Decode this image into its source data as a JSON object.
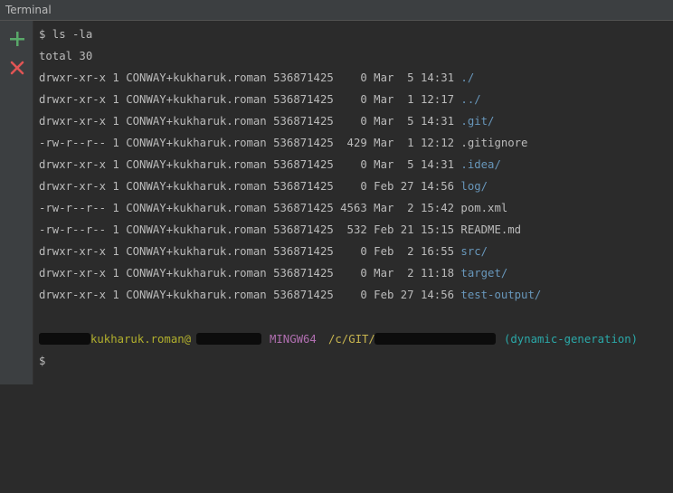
{
  "window": {
    "title": "Terminal"
  },
  "sidebar": {
    "icons": [
      {
        "name": "plus-icon",
        "color": "#59a869"
      },
      {
        "name": "close-icon",
        "color": "#e05555"
      }
    ]
  },
  "terminal": {
    "command": "$ ls -la",
    "total": "total 30",
    "entries": [
      {
        "meta": "drwxr-xr-x 1 CONWAY+kukharuk.roman 536871425    0 Mar  5 14:31 ",
        "name": "./",
        "is_dir": true
      },
      {
        "meta": "drwxr-xr-x 1 CONWAY+kukharuk.roman 536871425    0 Mar  1 12:17 ",
        "name": "../",
        "is_dir": true
      },
      {
        "meta": "drwxr-xr-x 1 CONWAY+kukharuk.roman 536871425    0 Mar  5 14:31 ",
        "name": ".git/",
        "is_dir": true
      },
      {
        "meta": "-rw-r--r-- 1 CONWAY+kukharuk.roman 536871425  429 Mar  1 12:12 ",
        "name": ".gitignore",
        "is_dir": false
      },
      {
        "meta": "drwxr-xr-x 1 CONWAY+kukharuk.roman 536871425    0 Mar  5 14:31 ",
        "name": ".idea/",
        "is_dir": true
      },
      {
        "meta": "drwxr-xr-x 1 CONWAY+kukharuk.roman 536871425    0 Feb 27 14:56 ",
        "name": "log/",
        "is_dir": true
      },
      {
        "meta": "-rw-r--r-- 1 CONWAY+kukharuk.roman 536871425 4563 Mar  2 15:42 ",
        "name": "pom.xml",
        "is_dir": false
      },
      {
        "meta": "-rw-r--r-- 1 CONWAY+kukharuk.roman 536871425  532 Feb 21 15:15 ",
        "name": "README.md",
        "is_dir": false
      },
      {
        "meta": "drwxr-xr-x 1 CONWAY+kukharuk.roman 536871425    0 Feb  2 16:55 ",
        "name": "src/",
        "is_dir": true
      },
      {
        "meta": "drwxr-xr-x 1 CONWAY+kukharuk.roman 536871425    0 Mar  2 11:18 ",
        "name": "target/",
        "is_dir": true
      },
      {
        "meta": "drwxr-xr-x 1 CONWAY+kukharuk.roman 536871425    0 Feb 27 14:56 ",
        "name": "test-output/",
        "is_dir": true
      }
    ],
    "prompt": {
      "user": "kukharuk.roman@",
      "system": "MINGW64",
      "path": "/c/GIT/",
      "branch": "(dynamic-generation)",
      "symbol": "$",
      "colors": {
        "user": "#b2b02d",
        "system": "#b16fb1",
        "path": "#c8b54f",
        "branch": "#2ba8a8"
      }
    }
  }
}
